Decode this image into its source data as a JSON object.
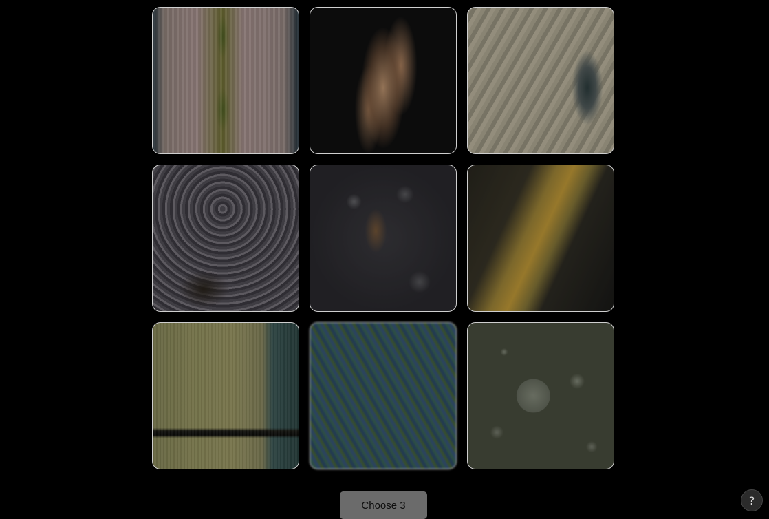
{
  "tiles": [
    {
      "id": "tile-1",
      "icon": "abstract-texture-image"
    },
    {
      "id": "tile-2",
      "icon": "abstract-texture-image"
    },
    {
      "id": "tile-3",
      "icon": "abstract-texture-image"
    },
    {
      "id": "tile-4",
      "icon": "abstract-texture-image"
    },
    {
      "id": "tile-5",
      "icon": "abstract-texture-image"
    },
    {
      "id": "tile-6",
      "icon": "abstract-texture-image"
    },
    {
      "id": "tile-7",
      "icon": "abstract-texture-image"
    },
    {
      "id": "tile-8",
      "icon": "abstract-texture-image"
    },
    {
      "id": "tile-9",
      "icon": "abstract-texture-image"
    }
  ],
  "actions": {
    "choose_label": "Choose 3",
    "help_label": "?"
  },
  "colors": {
    "background": "#000000",
    "button_bg": "#6b6b6b",
    "tile_border": "#cfcfcf"
  }
}
